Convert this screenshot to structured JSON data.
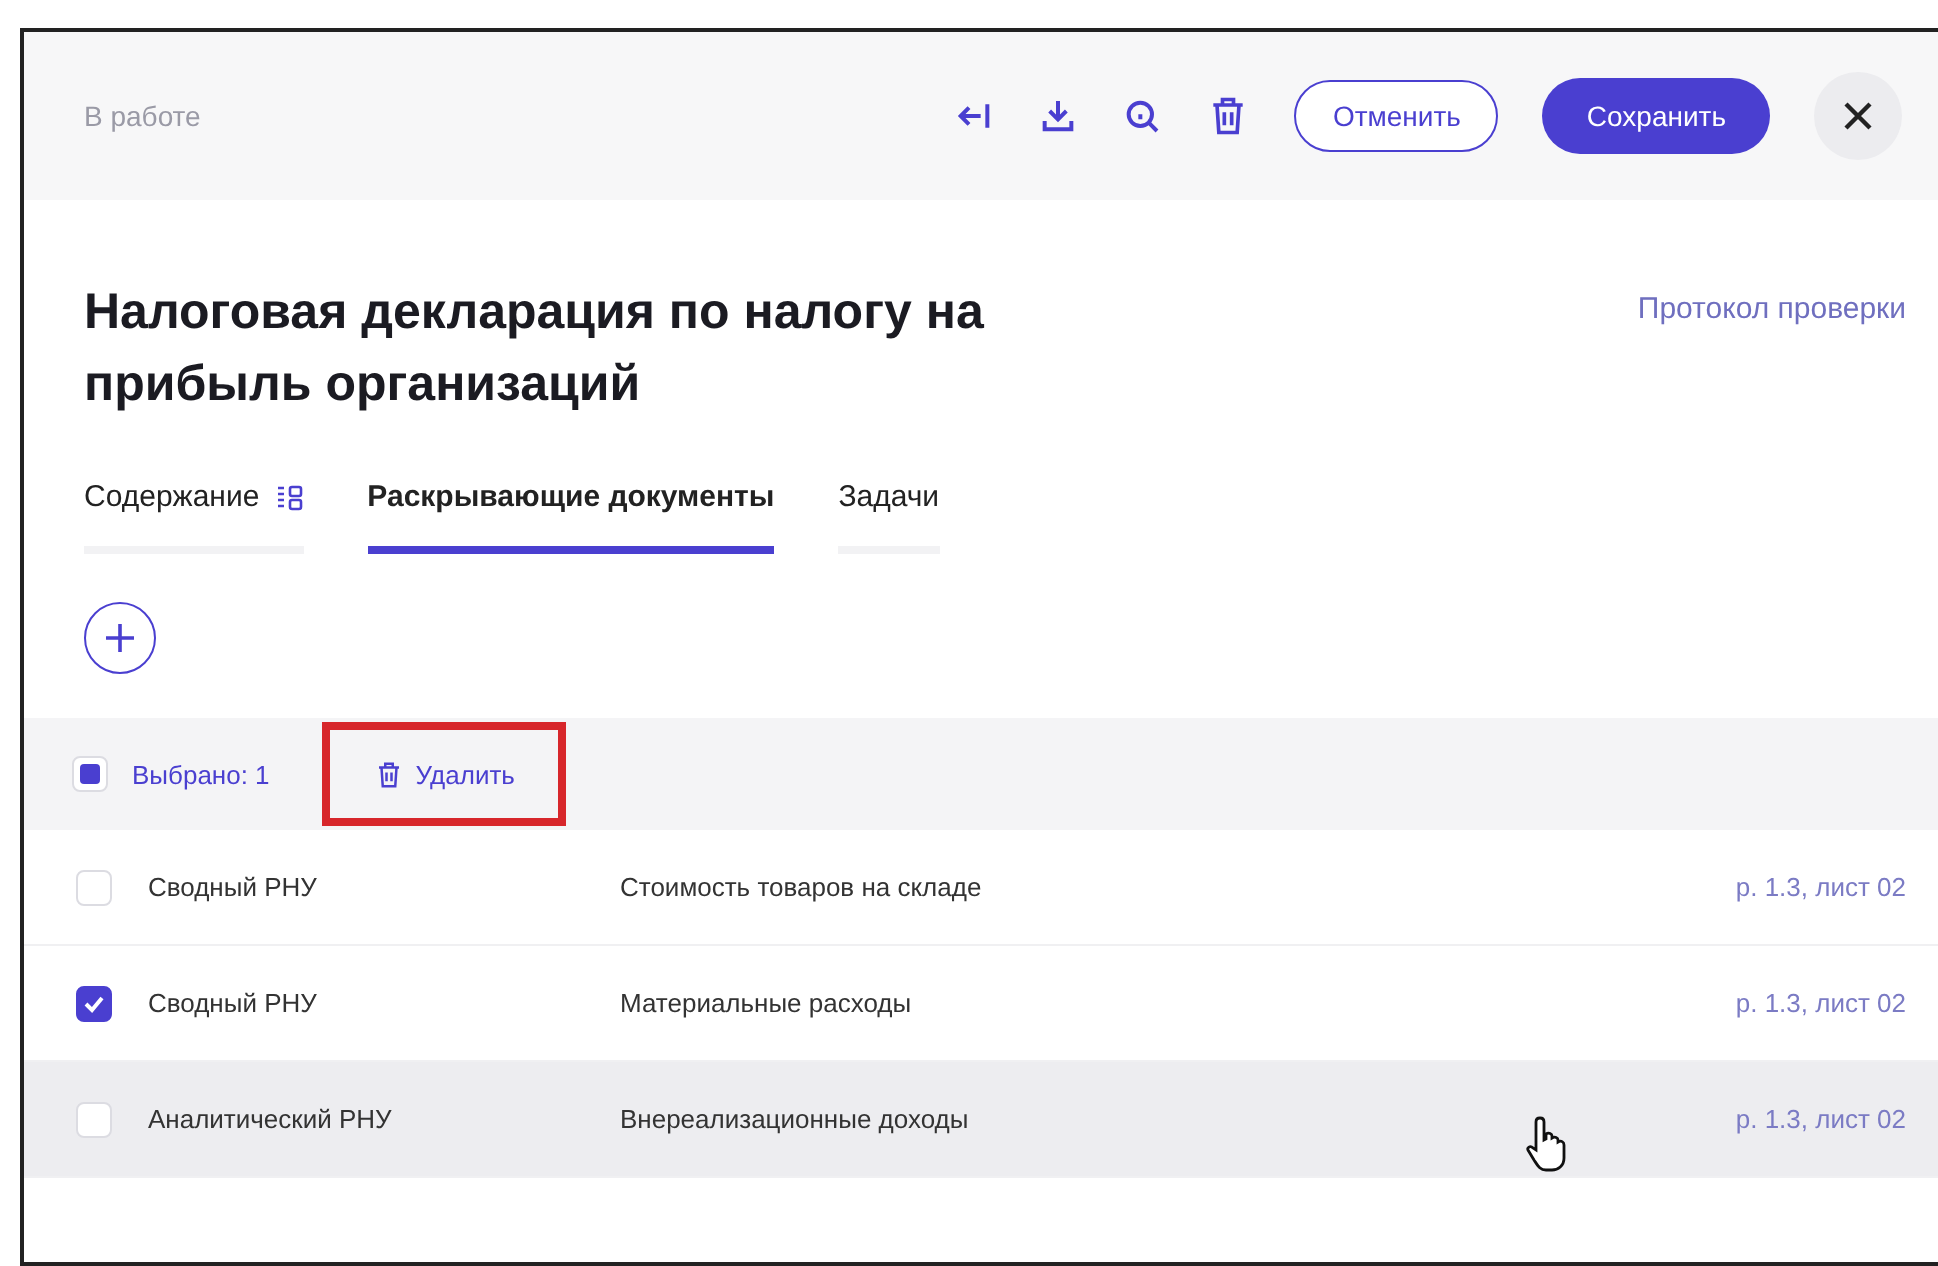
{
  "header": {
    "status": "В работе",
    "cancel_button": "Отменить",
    "save_button": "Сохранить"
  },
  "title": "Налоговая декларация по налогу на прибыль организаций",
  "report_link": "Протокол проверки",
  "tabs": [
    {
      "label": "Содержание",
      "selected": false,
      "has_icon": true
    },
    {
      "label": "Раскрывающие документы",
      "selected": true,
      "has_icon": false
    },
    {
      "label": "Задачи",
      "selected": false,
      "has_icon": false
    }
  ],
  "selection_bar": {
    "indeterminate": true,
    "count_label": "Выбрано: 1",
    "delete_label": "Удалить",
    "delete_highlighted": true
  },
  "rows": [
    {
      "type": "Сводный РНУ",
      "name": "Стоимость товаров на складе",
      "ref": "р. 1.3, лист 02",
      "checked": false,
      "hovered": false
    },
    {
      "type": "Сводный РНУ",
      "name": "Материальные расходы",
      "ref": "р. 1.3, лист 02",
      "checked": true,
      "hovered": false
    },
    {
      "type": "Аналитический РНУ",
      "name": "Внереализационные доходы",
      "ref": "р. 1.3, лист 02",
      "checked": false,
      "hovered": true
    }
  ]
}
